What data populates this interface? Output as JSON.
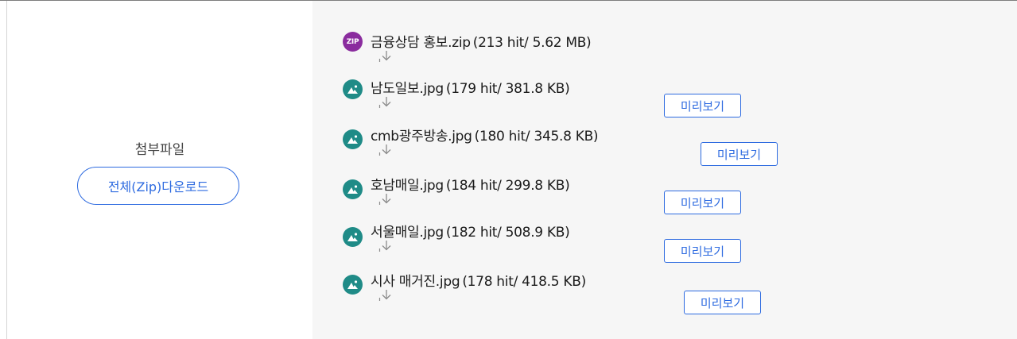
{
  "attachments": {
    "label": "첨부파일",
    "zip_download_label": "전체(Zip)다운로드",
    "preview_label": "미리보기",
    "files": [
      {
        "name": "금융상담 홍보.zip",
        "meta": "(213 hit/ 5.62 MB)",
        "icon": "zip-icon",
        "icon_text": "ZIP",
        "has_preview": false
      },
      {
        "name": "남도일보.jpg",
        "meta": "(179 hit/ 381.8 KB)",
        "icon": "image-icon",
        "has_preview": true
      },
      {
        "name": "cmb광주방송.jpg",
        "meta": "(180 hit/ 345.8 KB)",
        "icon": "image-icon",
        "has_preview": true
      },
      {
        "name": "호남매일.jpg",
        "meta": "(184 hit/ 299.8 KB)",
        "icon": "image-icon",
        "has_preview": true
      },
      {
        "name": "서울매일.jpg",
        "meta": "(182 hit/ 508.9 KB)",
        "icon": "image-icon",
        "has_preview": true
      },
      {
        "name": "시사 매거진.jpg",
        "meta": "(178 hit/ 418.5 KB)",
        "icon": "image-icon",
        "has_preview": true
      }
    ]
  },
  "colors": {
    "accent_blue": "#2e6be0",
    "zip_icon_bg": "#8a2c9e",
    "image_icon_bg": "#1f8b87",
    "content_bg": "#f6f6f6"
  }
}
